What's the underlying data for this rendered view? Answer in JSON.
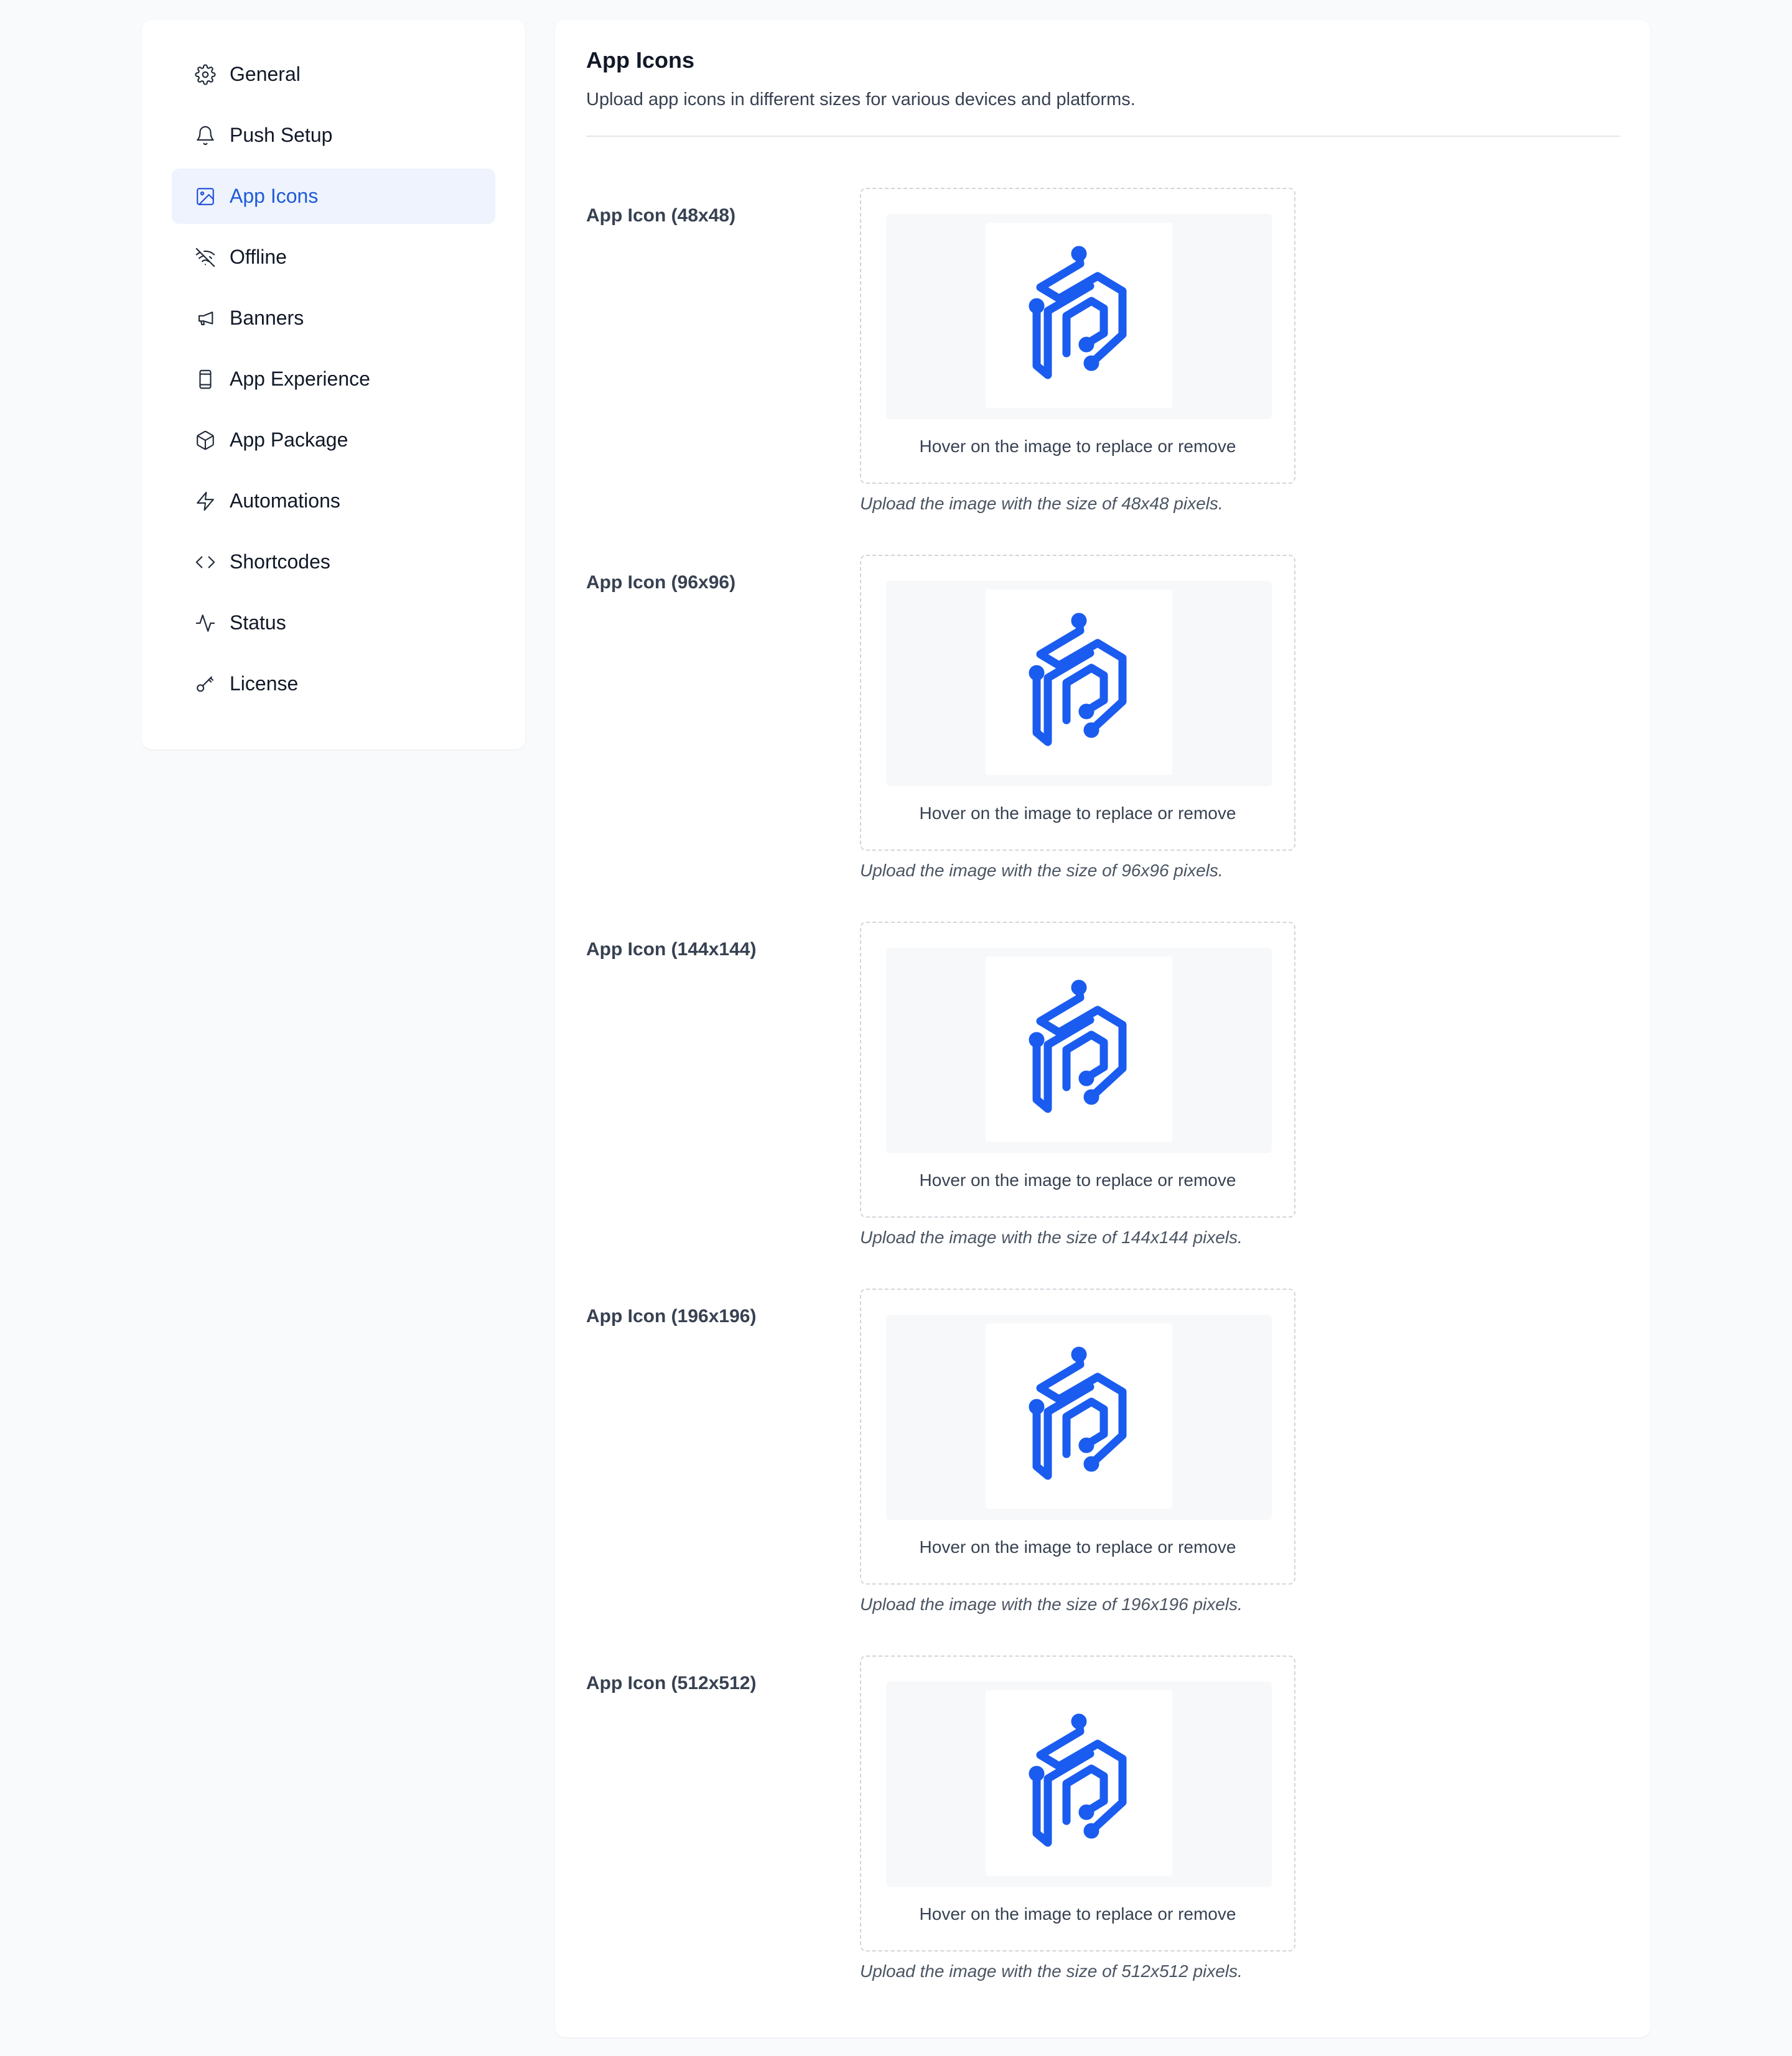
{
  "sidebar": {
    "items": [
      {
        "label": "General",
        "icon": "gear-icon",
        "active": false
      },
      {
        "label": "Push Setup",
        "icon": "bell-icon",
        "active": false
      },
      {
        "label": "App Icons",
        "icon": "image-icon",
        "active": true
      },
      {
        "label": "Offline",
        "icon": "wifi-off-icon",
        "active": false
      },
      {
        "label": "Banners",
        "icon": "megaphone-icon",
        "active": false
      },
      {
        "label": "App Experience",
        "icon": "phone-icon",
        "active": false
      },
      {
        "label": "App Package",
        "icon": "package-icon",
        "active": false
      },
      {
        "label": "Automations",
        "icon": "lightning-icon",
        "active": false
      },
      {
        "label": "Shortcodes",
        "icon": "code-icon",
        "active": false
      },
      {
        "label": "Status",
        "icon": "activity-icon",
        "active": false
      },
      {
        "label": "License",
        "icon": "key-icon",
        "active": false
      }
    ]
  },
  "main": {
    "title": "App Icons",
    "description": "Upload app icons in different sizes for various devices and platforms.",
    "icons": [
      {
        "label": "App Icon (48x48)",
        "hover_text": "Hover on the image to replace or remove",
        "hint": "Upload the image with the size of 48x48 pixels."
      },
      {
        "label": "App Icon (96x96)",
        "hover_text": "Hover on the image to replace or remove",
        "hint": "Upload the image with the size of 96x96 pixels."
      },
      {
        "label": "App Icon (144x144)",
        "hover_text": "Hover on the image to replace or remove",
        "hint": "Upload the image with the size of 144x144 pixels."
      },
      {
        "label": "App Icon (196x196)",
        "hover_text": "Hover on the image to replace or remove",
        "hint": "Upload the image with the size of 196x196 pixels."
      },
      {
        "label": "App Icon (512x512)",
        "hover_text": "Hover on the image to replace or remove",
        "hint": "Upload the image with the size of 512x512 pixels."
      }
    ]
  },
  "colors": {
    "accent": "#1e5bd6",
    "active_bg": "#eef3fe",
    "logo_blue": "#1a5cf0",
    "page_bg": "#f8fafc"
  }
}
